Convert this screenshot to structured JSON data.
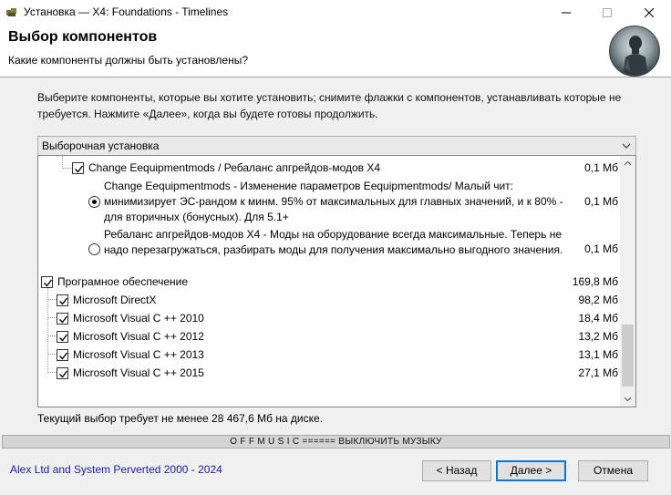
{
  "window": {
    "title": "Установка — X4: Foundations - Timelines",
    "icon": "installer-icon",
    "controls": [
      "minimize-icon",
      "maximize-icon",
      "close-icon"
    ]
  },
  "header": {
    "title": "Выбор компонентов",
    "subtitle": "Какие компоненты должны быть установлены?"
  },
  "instructions": "Выберите компоненты, которые вы хотите установить; снимите флажки с компонентов, устанавливать которые не требуется. Нажмите «Далее», когда вы будете готовы продолжить.",
  "install_type": "Выборочная установка",
  "components": {
    "change_mods": {
      "label": "Change Eequipmentmods / Ребаланс апгрейдов-модов X4",
      "size": "0,1 Мб",
      "checked": true
    },
    "option_1": {
      "label": "Change Eequipmentmods - Изменение параметров Eequipmentmods/ Малый чит: минимизирует ЭС-рандом к минм. 95% от максимальных для главных значений, и к 80% - для вторичных (бонусных). Для 5.1+",
      "size": "0,1 Мб",
      "selected": true
    },
    "option_2": {
      "label": "Ребаланс апгрейдов-модов X4 - Моды на оборудование всегда максимальные. Теперь не надо перезагружаться, разбирать моды для получения максимально выгодного значения.",
      "size": "0,1 Мб",
      "selected": false
    },
    "software": {
      "label": "Програмное обеспечение",
      "size": "169,8 Мб",
      "checked": true
    },
    "directx": {
      "label": "Microsoft DirectX",
      "size": "98,2 Мб",
      "checked": true
    },
    "vc2010": {
      "label": "Microsoft Visual C ++ 2010",
      "size": "18,4 Мб",
      "checked": true
    },
    "vc2012": {
      "label": "Microsoft Visual C ++ 2012",
      "size": "13,2 Мб",
      "checked": true
    },
    "vc2013": {
      "label": "Microsoft Visual C ++ 2013",
      "size": "13,1 Мб",
      "checked": true
    },
    "vc2015": {
      "label": "Microsoft Visual C ++ 2015",
      "size": "27,1 Мб",
      "checked": true
    }
  },
  "requirement": "Текущий выбор требует не менее 28 467,6 Мб на диске.",
  "music_bar": "O F F M U S I C ====== ВЫКЛЮЧИТЬ МУЗЫКУ",
  "copyright": "Alex Ltd and System Perverted 2000 - 2024",
  "buttons": {
    "back": "< Назад",
    "next": "Далее >",
    "cancel": "Отмена"
  },
  "colors": {
    "accent": "#0078d7",
    "copyright": "#1a1aa6"
  }
}
